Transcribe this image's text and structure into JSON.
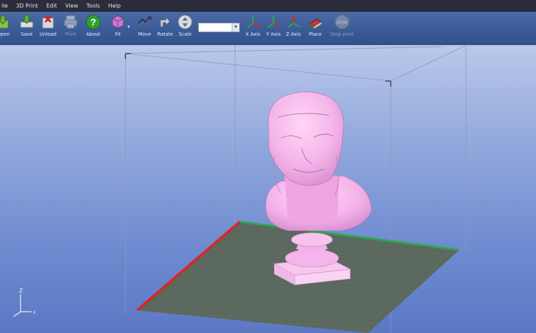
{
  "menubar": {
    "items": [
      {
        "label": "ile"
      },
      {
        "label": "3D Print"
      },
      {
        "label": "Edit"
      },
      {
        "label": "View"
      },
      {
        "label": "Tools"
      },
      {
        "label": "Help"
      }
    ]
  },
  "toolbar": {
    "open_label": "Open",
    "save_label": "Save",
    "unload_label": "Unload",
    "print_label": "Print",
    "about_label": "About",
    "fit_label": "Fit",
    "move_label": "Move",
    "rotate_label": "Rotate",
    "scale_label": "Scale",
    "combo_value": "",
    "xaxis_label": "X Axis",
    "yaxis_label": "Y Axis",
    "zaxis_label": "Z Axis",
    "place_label": "Place",
    "stop_label": "Stop print",
    "stop_sign_text": "STOP"
  },
  "viewport": {
    "axis_z_label": "Z",
    "axis_x_label": "X",
    "colors": {
      "bed": "#5d6a5f",
      "bed_grid": "#4c5850",
      "x_edge": "#d22a2a",
      "y_edge": "#2aa84a",
      "model": "#f4b5ea",
      "frame": "#8e97b8"
    }
  }
}
